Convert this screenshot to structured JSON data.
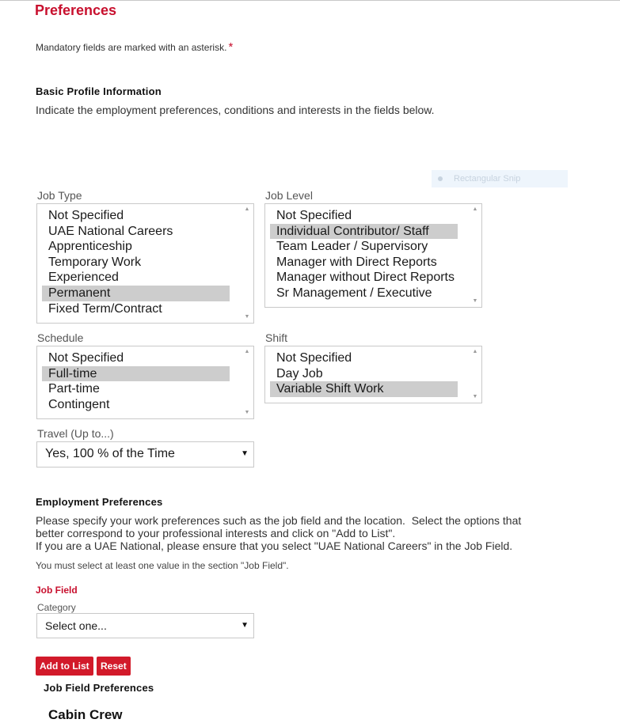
{
  "page": {
    "title": "Preferences",
    "mandatory_note": "Mandatory fields are marked with an asterisk.",
    "asterisk": "*"
  },
  "basic_profile": {
    "heading": "Basic Profile Information",
    "description": "Indicate the employment preferences, conditions and interests in the fields below."
  },
  "overlay": {
    "snip_label": "Rectangular Snip"
  },
  "job_type": {
    "label": "Job Type",
    "options": [
      "Not Specified",
      "UAE National Careers",
      "Apprenticeship",
      "Temporary Work",
      "Experienced",
      "Permanent",
      "Fixed Term/Contract"
    ],
    "selected": "Permanent"
  },
  "job_level": {
    "label": "Job Level",
    "options": [
      "Not Specified",
      "Individual Contributor/ Staff",
      "Team Leader / Supervisory",
      "Manager with Direct Reports",
      "Manager without Direct Reports",
      "Sr Management / Executive"
    ],
    "selected": "Individual Contributor/ Staff"
  },
  "schedule": {
    "label": "Schedule",
    "options": [
      "Not Specified",
      "Full-time",
      "Part-time",
      "Contingent"
    ],
    "selected": "Full-time"
  },
  "shift": {
    "label": "Shift",
    "options": [
      "Not Specified",
      "Day Job",
      "Variable Shift Work"
    ],
    "selected": "Variable Shift Work"
  },
  "travel": {
    "label": "Travel (Up to...)",
    "value": "Yes, 100 % of the Time"
  },
  "employment": {
    "heading": "Employment Preferences",
    "description_line1": "Please specify your work preferences such as the job field and the location.  Select the options that",
    "description_line2": "better correspond to your professional interests and click on \"Add to List\".",
    "description_line3": "If you are a UAE National, please ensure that you select \"UAE National Careers\" in the Job Field.",
    "requirement_note": "You must select at least one value in the section \"Job Field\"."
  },
  "job_field": {
    "heading": "Job Field",
    "category_label": "Category",
    "category_value": "Select one...",
    "add_button": "Add to List",
    "reset_button": "Reset",
    "preferences_heading": "Job Field Preferences",
    "preferences": [
      "Cabin Crew"
    ]
  },
  "colors": {
    "accent": "#c8102e",
    "button": "#d21a2a",
    "selected_option": "#cdcdcd"
  }
}
